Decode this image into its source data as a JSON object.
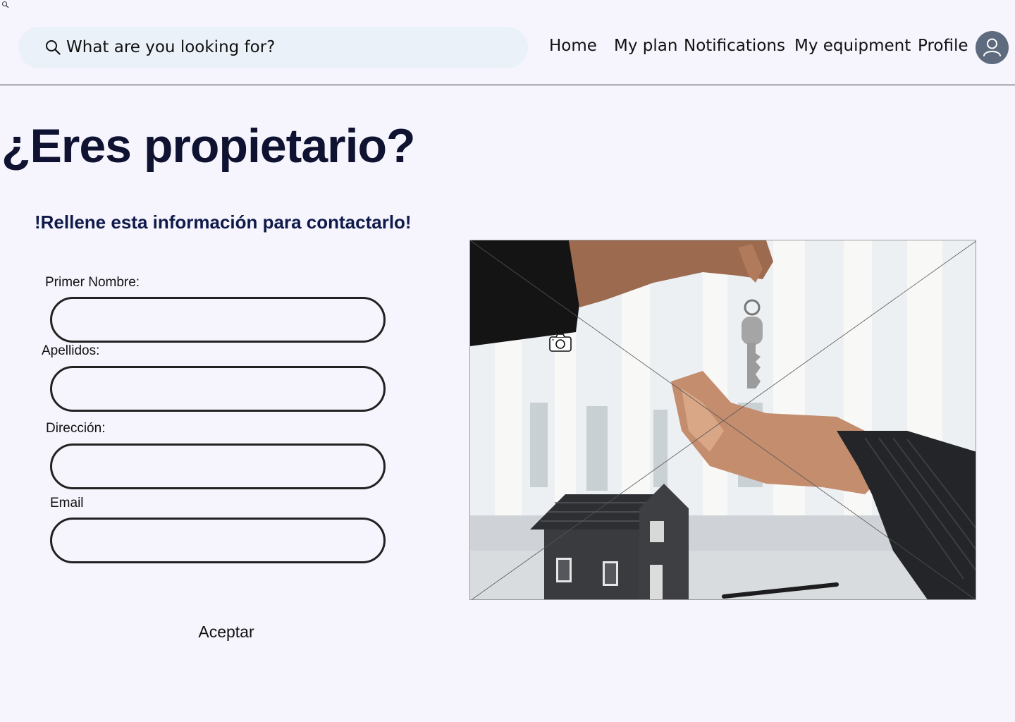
{
  "header": {
    "search": {
      "placeholder": "What are you looking for?"
    },
    "nav": {
      "home": "Home",
      "my_plan": "My plan",
      "notifications": "Notifications",
      "my_equipment": "My equipment",
      "profile": "Profile"
    },
    "avatar_icon": "user-icon"
  },
  "main": {
    "title": "¿Eres propietario?",
    "subtitle": "!Rellene esta información para contactarlo!",
    "form": {
      "first_name_label": "Primer Nombre:",
      "last_name_label": "Apellidos:",
      "address_label": "Dirección:",
      "email_label": "Email",
      "first_name_value": "",
      "last_name_value": "",
      "address_value": "",
      "email_value": "",
      "submit_label": "Aceptar"
    },
    "image_icon": "camera-icon"
  },
  "colors": {
    "background": "#f6f5fd",
    "search_bg": "#ebf1f8",
    "title": "#0f1230",
    "avatar": "#5e6a7e"
  }
}
